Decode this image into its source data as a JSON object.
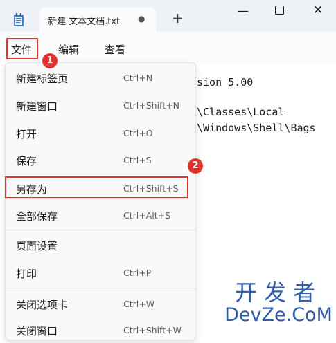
{
  "window": {
    "tab_title": "新建 文本文档.txt",
    "tab_modified_glyph": "●",
    "tab_add_glyph": "+",
    "minimize_glyph": "—",
    "close_glyph": "✕"
  },
  "menubar": {
    "file": "文件",
    "edit": "编辑",
    "view": "查看"
  },
  "badges": {
    "first": "1",
    "second": "2"
  },
  "editor_lines": [
    "sion 5.00",
    "\\Classes\\Local",
    "\\Windows\\Shell\\Bags"
  ],
  "file_menu": {
    "items": [
      {
        "label": "新建标签页",
        "shortcut": "Ctrl+N"
      },
      {
        "label": "新建窗口",
        "shortcut": "Ctrl+Shift+N"
      },
      {
        "label": "打开",
        "shortcut": "Ctrl+O"
      },
      {
        "label": "保存",
        "shortcut": "Ctrl+S"
      },
      {
        "label": "另存为",
        "shortcut": "Ctrl+Shift+S"
      },
      {
        "label": "全部保存",
        "shortcut": "Ctrl+Alt+S"
      },
      {
        "label": "页面设置",
        "shortcut": ""
      },
      {
        "label": "打印",
        "shortcut": "Ctrl+P"
      },
      {
        "label": "关闭选项卡",
        "shortcut": "Ctrl+W"
      },
      {
        "label": "关闭窗口",
        "shortcut": "Ctrl+Shift+W"
      }
    ]
  },
  "watermark": {
    "cn": "开发者",
    "en": "DevZe.CoM"
  },
  "colors": {
    "highlight": "#e0332f",
    "watermark": "#2f5da8",
    "titlebar": "#eef1f5"
  }
}
